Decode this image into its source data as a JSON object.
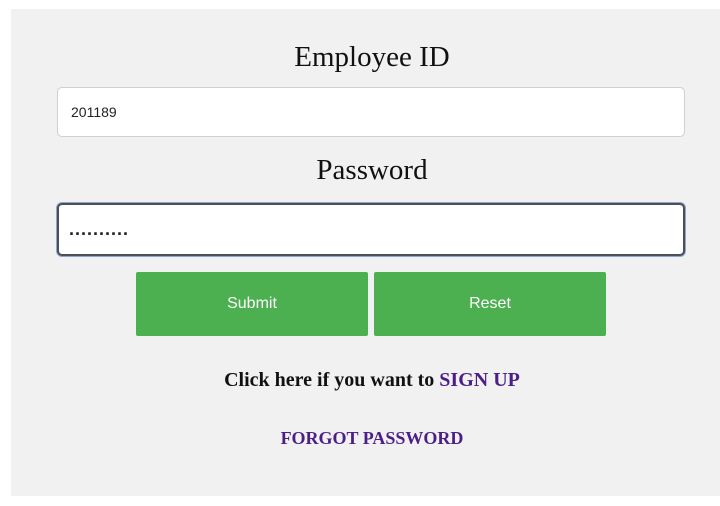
{
  "form": {
    "employee_id_label": "Employee ID",
    "employee_id_value": "201189",
    "password_label": "Password",
    "password_value": "..........",
    "submit_label": "Submit",
    "reset_label": "Reset",
    "signup_prompt": "Click here if you want to ",
    "signup_link": "SIGN UP",
    "forgot_link": "FORGOT PASSWORD"
  },
  "colors": {
    "panel_background": "#f1f1f1",
    "button_green": "#4caf50",
    "link_purple": "#4b1f87",
    "focus_border": "#4a4f5a"
  }
}
